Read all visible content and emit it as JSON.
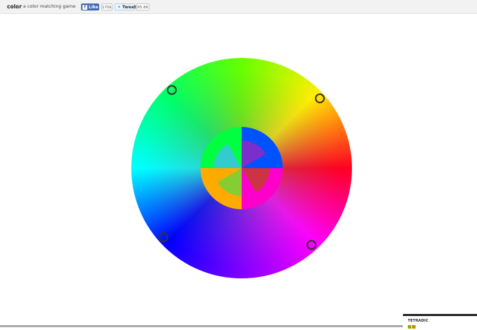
{
  "header": {
    "brand": "color",
    "tagline": "a color matching game",
    "fb_like_label": "Like",
    "fb_like_count": "170k",
    "tweet_label": "Tweet",
    "tweet_count": "65.6K"
  },
  "wheel": {
    "markers": 4,
    "center_colors": [
      "#0052ff",
      "#ff00cc",
      "#ffaa00",
      "#00ff40"
    ],
    "inner_colors": [
      "#7a2ecc",
      "#cc3344",
      "#88cc33",
      "#33cccc"
    ]
  },
  "scheme": {
    "name": "TETRADIC",
    "swatches": [
      "#9aaa00",
      "#cc8800"
    ]
  }
}
